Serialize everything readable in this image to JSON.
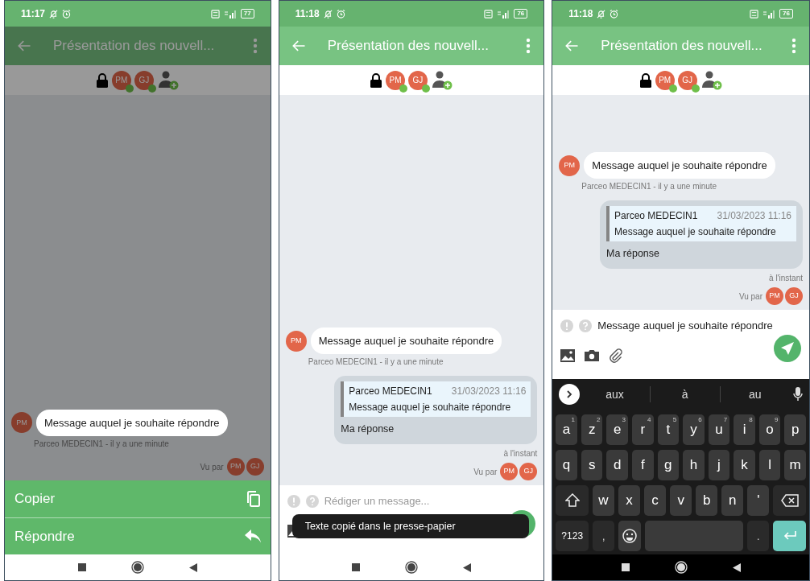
{
  "screens": [
    {
      "status_bar": {
        "time": "11:17",
        "battery": "77"
      },
      "app_bar": {
        "title": "Présentation des nouvell..."
      },
      "dimmed": true,
      "participants": [
        {
          "initials": "PM",
          "online": true
        },
        {
          "initials": "GJ",
          "online": true
        }
      ],
      "messages": [
        {
          "kind": "incoming",
          "avatar": "PM",
          "text": "Message auquel je souhaite répondre",
          "meta": "Parceo MEDECIN1 - il y a une minute",
          "highlighted": true
        }
      ],
      "seen_by": {
        "label": "Vu par",
        "avatars": [
          "PM",
          "GJ"
        ]
      },
      "action_sheet": [
        {
          "label": "Copier"
        },
        {
          "label": "Répondre"
        }
      ]
    },
    {
      "status_bar": {
        "time": "11:18",
        "battery": "76"
      },
      "app_bar": {
        "title": "Présentation des nouvell..."
      },
      "dimmed": false,
      "participants": [
        {
          "initials": "PM",
          "online": true
        },
        {
          "initials": "GJ",
          "online": true
        }
      ],
      "messages": [
        {
          "kind": "incoming",
          "avatar": "PM",
          "text": "Message auquel je souhaite répondre",
          "meta": "Parceo MEDECIN1 - il y a une minute"
        },
        {
          "kind": "outgoing",
          "quote": {
            "author": "Parceo MEDECIN1",
            "date": "31/03/2023 11:16",
            "text": "Message auquel je souhaite répondre"
          },
          "text": "Ma réponse",
          "meta": "à l'instant"
        }
      ],
      "seen_by": {
        "label": "Vu par",
        "avatars": [
          "PM",
          "GJ"
        ]
      },
      "composer": {
        "placeholder": "Rédiger un message..."
      },
      "toast": "Texte copié dans le presse-papier"
    },
    {
      "status_bar": {
        "time": "11:18",
        "battery": "76"
      },
      "app_bar": {
        "title": "Présentation des nouvell..."
      },
      "dimmed": false,
      "participants": [
        {
          "initials": "PM",
          "online": true
        },
        {
          "initials": "GJ",
          "online": true
        }
      ],
      "messages": [
        {
          "kind": "incoming",
          "avatar": "PM",
          "text": "Message auquel je souhaite répondre",
          "meta": "Parceo MEDECIN1 - il y a une minute"
        },
        {
          "kind": "outgoing",
          "quote": {
            "author": "Parceo MEDECIN1",
            "date": "31/03/2023 11:16",
            "text": "Message auquel je souhaite répondre"
          },
          "text": "Ma réponse",
          "meta": "à l'instant"
        }
      ],
      "seen_by": {
        "label": "Vu par",
        "avatars": [
          "PM",
          "GJ"
        ]
      },
      "composer": {
        "value": "Message auquel je souhaite répondre"
      },
      "keyboard": {
        "suggestions": [
          "aux",
          "à",
          "au"
        ],
        "rows": [
          [
            {
              "kind": "char",
              "label": "a",
              "hint": "1"
            },
            {
              "kind": "char",
              "label": "z",
              "hint": "2"
            },
            {
              "kind": "char",
              "label": "e",
              "hint": "3"
            },
            {
              "kind": "char",
              "label": "r",
              "hint": "4"
            },
            {
              "kind": "char",
              "label": "t",
              "hint": "5"
            },
            {
              "kind": "char",
              "label": "y",
              "hint": "6"
            },
            {
              "kind": "char",
              "label": "u",
              "hint": "7"
            },
            {
              "kind": "char",
              "label": "i",
              "hint": "8"
            },
            {
              "kind": "char",
              "label": "o",
              "hint": "9"
            },
            {
              "kind": "char",
              "label": "p"
            }
          ],
          [
            {
              "kind": "char",
              "label": "q"
            },
            {
              "kind": "char",
              "label": "s"
            },
            {
              "kind": "char",
              "label": "d"
            },
            {
              "kind": "char",
              "label": "f"
            },
            {
              "kind": "char",
              "label": "g"
            },
            {
              "kind": "char",
              "label": "h"
            },
            {
              "kind": "char",
              "label": "j"
            },
            {
              "kind": "char",
              "label": "k"
            },
            {
              "kind": "char",
              "label": "l"
            },
            {
              "kind": "char",
              "label": "m"
            }
          ],
          [
            {
              "kind": "shift"
            },
            {
              "kind": "char",
              "label": "w"
            },
            {
              "kind": "char",
              "label": "x"
            },
            {
              "kind": "char",
              "label": "c"
            },
            {
              "kind": "char",
              "label": "v"
            },
            {
              "kind": "char",
              "label": "b"
            },
            {
              "kind": "char",
              "label": "n"
            },
            {
              "kind": "char",
              "label": "'"
            },
            {
              "kind": "backspace"
            }
          ],
          [
            {
              "kind": "symbols",
              "label": "?123"
            },
            {
              "kind": "punct",
              "label": ","
            },
            {
              "kind": "emoji"
            },
            {
              "kind": "space"
            },
            {
              "kind": "punct",
              "label": "."
            },
            {
              "kind": "enter"
            }
          ]
        ]
      }
    }
  ]
}
